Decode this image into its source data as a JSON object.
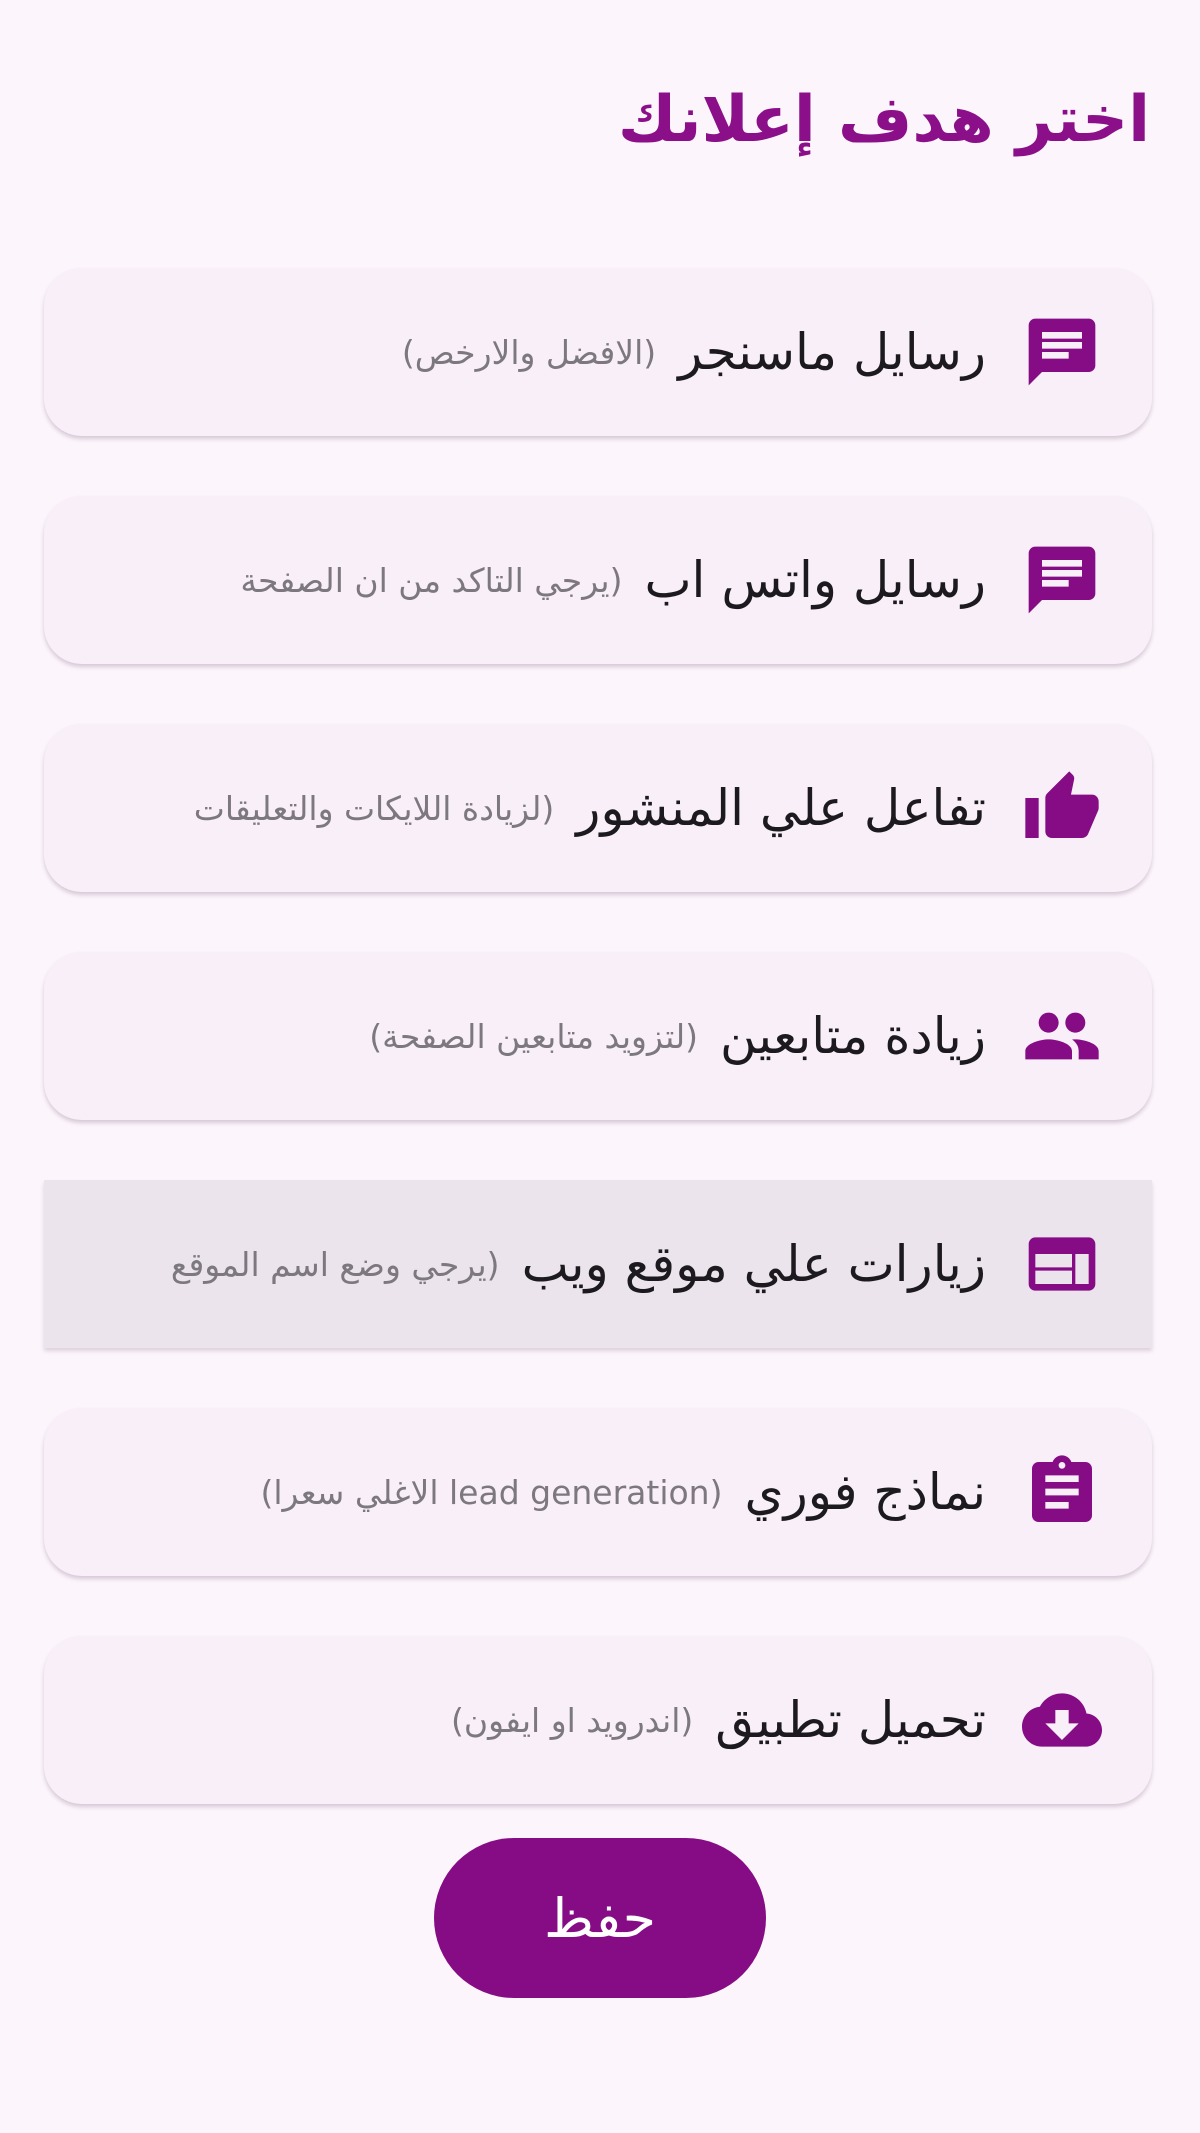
{
  "header": {
    "title": "اختر هدف إعلانك"
  },
  "colors": {
    "accent": "#850c84",
    "title": "#8a0f88",
    "background": "#fcf6fc",
    "card": "#f8eff8",
    "card_selected": "#ebe4ec",
    "label_text": "#1c1a1e",
    "sub_text": "#7d7880"
  },
  "options": [
    {
      "icon": "message-icon",
      "label": "رسايل ماسنجر",
      "sub": "(الافضل والارخص)",
      "selected": false
    },
    {
      "icon": "message-icon",
      "label": "رسايل واتس اب",
      "sub": "(يرجي التاكد من ان الصفحة",
      "selected": false
    },
    {
      "icon": "thumb-up-icon",
      "label": "تفاعل علي المنشور",
      "sub": "(لزيادة اللايكات والتعليقات",
      "selected": false
    },
    {
      "icon": "people-icon",
      "label": "زيادة متابعين",
      "sub": "(لتزويد متابعين الصفحة)",
      "selected": false
    },
    {
      "icon": "web-icon",
      "label": "زيارات علي موقع ويب",
      "sub": "(يرجي وضع اسم الموقع",
      "selected": true
    },
    {
      "icon": "clipboard-icon",
      "label": "نماذج فوري",
      "sub": "(lead generation الاغلي سعرا)",
      "selected": false
    },
    {
      "icon": "cloud-download-icon",
      "label": "تحميل تطبيق",
      "sub": "(اندرويد او ايفون)",
      "selected": false
    }
  ],
  "actions": {
    "save_label": "حفظ"
  }
}
